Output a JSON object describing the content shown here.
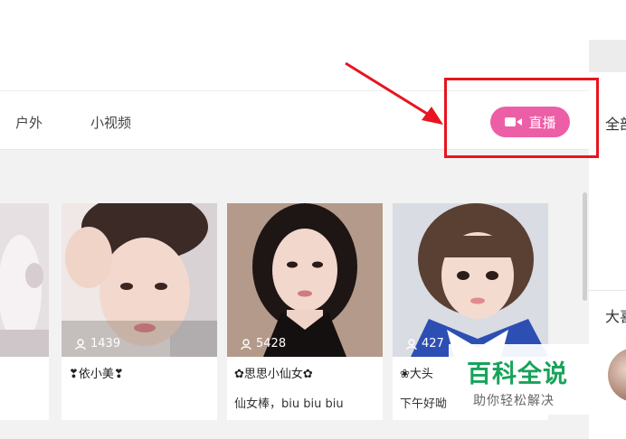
{
  "nav": {
    "items": [
      "户外",
      "小视频"
    ]
  },
  "live_button": {
    "label": "直播"
  },
  "right_panel": {
    "all_label": "全部",
    "big_label": "大喜"
  },
  "cards": [
    {
      "viewers": "",
      "name": "",
      "desc": ""
    },
    {
      "viewers": "1439",
      "name": "❣依小美❣",
      "desc": ""
    },
    {
      "viewers": "5428",
      "name": "✿思思小仙女✿",
      "desc": "仙女棒，biu biu biu"
    },
    {
      "viewers": "427",
      "name": "❀大头",
      "desc": "下午好呦"
    }
  ],
  "watermark": {
    "title": "百科全说",
    "subtitle": "助你轻松解决"
  },
  "colors": {
    "live_button": "#ec5fa6",
    "highlight": "#e8141f",
    "watermark_green": "#17a35a"
  }
}
